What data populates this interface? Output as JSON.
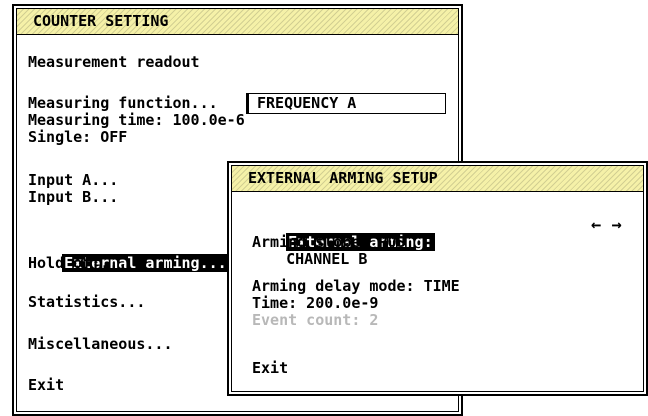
{
  "counter": {
    "title": "COUNTER SETTING",
    "measurement_readout": "Measurement readout",
    "measuring_function_label": "Measuring function...",
    "measuring_function_value": "FREQUENCY A",
    "measuring_time": "Measuring time: 100.0e-6",
    "single": "Single: OFF",
    "input_a": "Input A...",
    "input_b": "Input B...",
    "external_arming": "External arming...",
    "hold_off": "Hold off...",
    "statistics": "Statistics...",
    "miscellaneous": "Miscellaneous...",
    "exit": "Exit"
  },
  "arming": {
    "title": "EXTERNAL ARMING SETUP",
    "external_arming_label": "External arming:",
    "external_arming_value": "CHANNEL B",
    "arrows": "← →",
    "arming_slope": "Arming slope: POS",
    "arming_delay_mode": "Arming delay mode: TIME",
    "time": "Time: 200.0e-9",
    "event_count": "Event count: 2",
    "exit": "Exit"
  }
}
